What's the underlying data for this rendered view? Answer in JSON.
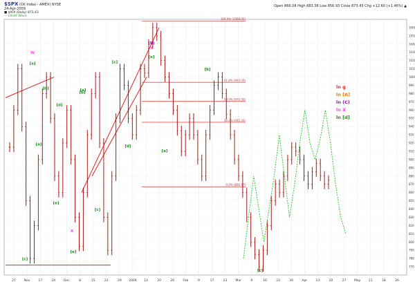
{
  "header": {
    "symbol": "$SPX",
    "title_line": "(Oil Index - AMEX) NYSE",
    "date_line": "24-Apr-2009",
    "indicator_line": "■ $XOI (Daily) 873.43",
    "wave_line": "— Elliott Wave",
    "stats_line": "Open 866.08 High 883.38 Low 856.93 Close 873.43 Chg +12.60 (+1.46%) ▲"
  },
  "chart_data": {
    "type": "line",
    "title": "",
    "x_ticks": [
      "27",
      "Nov",
      "17",
      "24",
      "Dec",
      "8",
      "15",
      "22",
      "29",
      "2009",
      "12",
      "20",
      "26",
      "Feb",
      "9",
      "17",
      "23",
      "Mar",
      "9",
      "16",
      "23",
      "30",
      "Apr",
      "13",
      "20",
      "27",
      "May",
      "11",
      "18",
      "26"
    ],
    "y_ticks": [
      770,
      780,
      790,
      800,
      810,
      820,
      830,
      840,
      850,
      860,
      870,
      880,
      890,
      900,
      910,
      920,
      930,
      940,
      950,
      960,
      970,
      980,
      990,
      1000,
      1010,
      1020,
      1030,
      1040,
      1050,
      1060
    ],
    "ylim": [
      760,
      1070
    ],
    "horizontal_lines": [
      {
        "label": "100.0% (1068.00)",
        "value": 1068
      },
      {
        "label": "61.8% (993.59)",
        "value": 993.59
      },
      {
        "label": "50.0% (970.58)",
        "value": 970.58
      },
      {
        "label": "38.2% (945.20)",
        "value": 945.2
      },
      {
        "label": "0.0% (866.97)",
        "value": 866.97
      }
    ],
    "legend": [
      {
        "label": "ln g",
        "color": "#ff2020"
      },
      {
        "label": "ln [A]",
        "color": "#ff7a00"
      },
      {
        "label": "ln (C)",
        "color": "#8a1aa6"
      },
      {
        "label": "ln X",
        "color": "#ff40ff"
      },
      {
        "label": "ln [d]",
        "color": "#1d8a1d"
      }
    ],
    "wave_labels": [
      {
        "text": "W",
        "color": "#ff40ff"
      },
      {
        "text": "[a]",
        "color": "#1d8a1d"
      },
      {
        "text": "[b]",
        "color": "#1d8a1d"
      },
      {
        "text": "[d]",
        "color": "#1d8a1d"
      },
      {
        "text": "[a]",
        "color": "#1d8a1d"
      },
      {
        "text": "[e]",
        "color": "#1d8a1d"
      },
      {
        "text": "[c]",
        "color": "#1d8a1d"
      },
      {
        "text": "[c]",
        "color": "#1d8a1d"
      },
      {
        "text": "X",
        "color": "#ff40ff"
      },
      {
        "text": "[e]",
        "color": "#1d8a1d"
      },
      {
        "text": "[b]",
        "color": "#1d8a1d"
      },
      {
        "text": "[a]",
        "color": "#1d8a1d"
      },
      {
        "text": "[c]",
        "color": "#1d8a1d"
      },
      {
        "text": "(B)",
        "color": "#8a1aa6"
      },
      {
        "text": "Y",
        "color": "#ff40ff"
      },
      {
        "text": "[e]",
        "color": "#1d8a1d"
      },
      {
        "text": "[d]",
        "color": "#1d8a1d"
      },
      {
        "text": "[b]",
        "color": "#1d8a1d"
      },
      {
        "text": "[a]",
        "color": "#1d8a1d"
      },
      {
        "text": "[c]",
        "color": "#1d8a1d"
      }
    ],
    "series": [
      {
        "name": "$XOI (Daily)",
        "values": [
          915,
          960,
          1010,
          940,
          850,
          780,
          820,
          900,
          980,
          1000,
          950,
          880,
          860,
          920,
          960,
          900,
          830,
          795,
          860,
          930,
          980,
          1000,
          920,
          830,
          790,
          880,
          950,
          1010,
          990,
          950,
          930,
          960,
          1010,
          1005,
          1040,
          1060,
          1050,
          1020,
          1000,
          980,
          960,
          935,
          910,
          930,
          950,
          930,
          900,
          880,
          930,
          960,
          990,
          1000,
          980,
          955,
          930,
          900,
          880,
          860,
          830,
          800,
          785,
          770,
          790,
          820,
          850,
          870,
          860,
          880,
          900,
          915,
          910,
          900,
          880,
          870,
          885,
          895,
          880,
          870,
          875
        ]
      },
      {
        "name": "Projection",
        "values": [
          780,
          830,
          880,
          840,
          800,
          840,
          880,
          930,
          880,
          830,
          870,
          920,
          960,
          920,
          900,
          925,
          960,
          920,
          870,
          830,
          810
        ]
      }
    ]
  }
}
